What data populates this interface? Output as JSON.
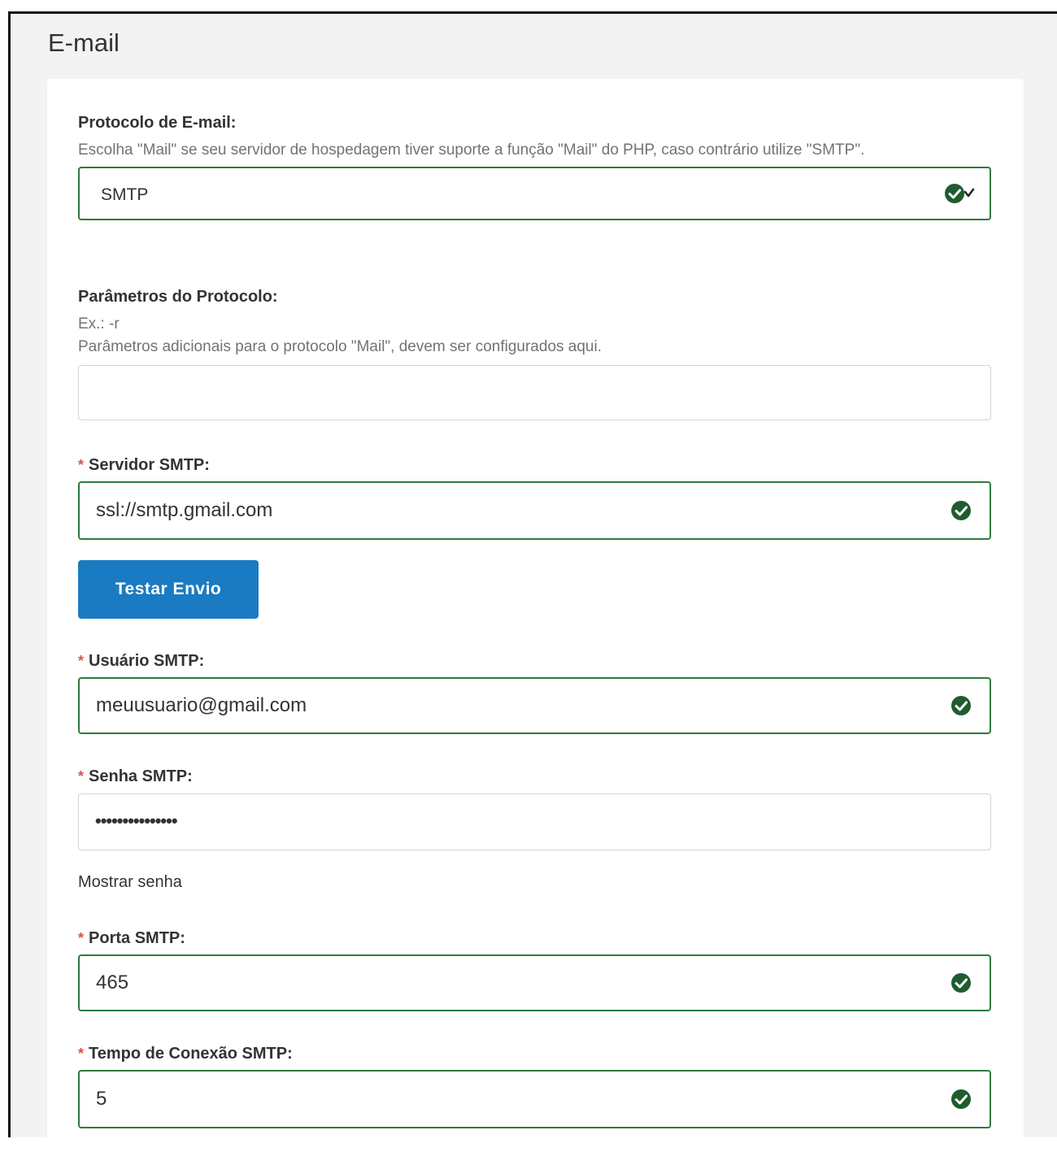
{
  "section_title": "E-mail",
  "protocol": {
    "label": "Protocolo de E-mail:",
    "help": "Escolha \"Mail\" se seu servidor de hospedagem tiver suporte a função \"Mail\" do PHP, caso contrário utilize \"SMTP\".",
    "selected": "SMTP"
  },
  "params": {
    "label": "Parâmetros do Protocolo:",
    "example": "Ex.: -r",
    "help": "Parâmetros adicionais para o protocolo \"Mail\", devem ser configurados aqui.",
    "value": ""
  },
  "smtp_server": {
    "required_mark": "*",
    "label": "Servidor SMTP:",
    "value": "ssl://smtp.gmail.com"
  },
  "test_button": {
    "label": "Testar Envio"
  },
  "smtp_user": {
    "required_mark": "*",
    "label": "Usuário SMTP:",
    "value": "meuusuario@gmail.com"
  },
  "smtp_password": {
    "required_mark": "*",
    "label": "Senha SMTP:",
    "masked_value": "•••••••••••••••",
    "show_password_label": "Mostrar senha"
  },
  "smtp_port": {
    "required_mark": "*",
    "label": "Porta SMTP:",
    "value": "465"
  },
  "smtp_timeout": {
    "required_mark": "*",
    "label": "Tempo de Conexão SMTP:",
    "value": "5"
  },
  "colors": {
    "valid_border": "#2d7a3e",
    "valid_icon": "#1f5c2e",
    "button_bg": "#1a7bc2",
    "required": "#d9534f"
  },
  "icons": {
    "valid": "check-circle-icon"
  }
}
